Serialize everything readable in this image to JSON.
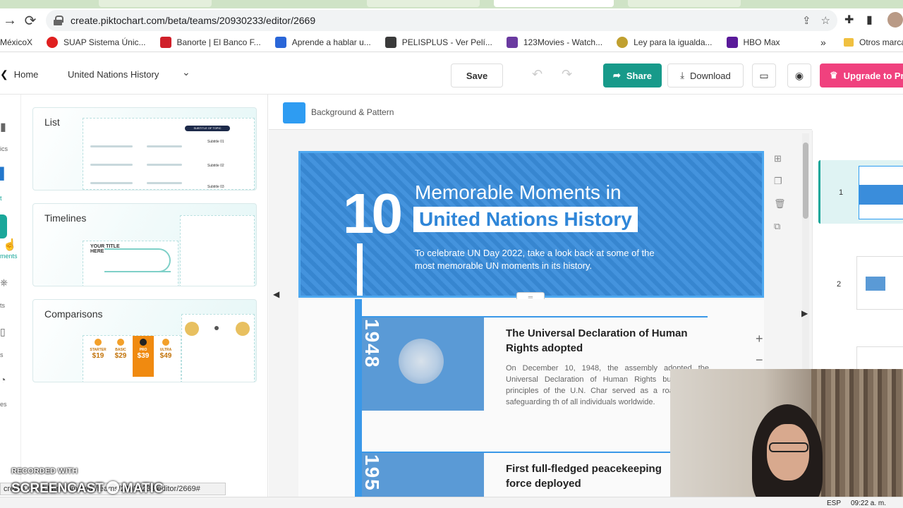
{
  "browser": {
    "url": "create.piktochart.com/beta/teams/20930233/editor/2669",
    "bookmarks": [
      {
        "label": "MéxicoX",
        "color": "#ffffff"
      },
      {
        "label": "SUAP Sistema Únic...",
        "color": "#e02020"
      },
      {
        "label": "Banorte | El Banco F...",
        "color": "#d0202a"
      },
      {
        "label": "Aprende a hablar u...",
        "color": "#2a66d8"
      },
      {
        "label": "PELISPLUS - Ver Pelí...",
        "color": "#3a3a3a"
      },
      {
        "label": "123Movies - Watch...",
        "color": "#6a3aa0"
      },
      {
        "label": "Ley para la igualda...",
        "color": "#c0a030"
      },
      {
        "label": "HBO Max",
        "color": "#5a1a9a"
      }
    ],
    "bookmarks_more": "»",
    "other_bookmarks": "Otros marca"
  },
  "header": {
    "home": "Home",
    "doc_title": "United Nations History",
    "save": "Save",
    "share": "Share",
    "download": "Download",
    "upgrade": "Upgrade to Pr"
  },
  "rail": [
    "ics",
    "t",
    "ments",
    "ts",
    "s",
    "es"
  ],
  "panel": {
    "cards": [
      {
        "title": "List",
        "subtitle_badge": "SUBTITLE OF TOPIC",
        "items": [
          "Subtitle 01",
          "Subtitle 02",
          "Subtitle 03"
        ]
      },
      {
        "title": "Timelines",
        "your_title": "YOUR TITLE HERE"
      },
      {
        "title": "Comparisons",
        "prices": [
          {
            "plan": "STARTER",
            "value": "$19"
          },
          {
            "plan": "BASIC",
            "value": "$29"
          },
          {
            "plan": "PRO",
            "value": "$39"
          },
          {
            "plan": "ULTRA",
            "value": "$49"
          }
        ]
      }
    ]
  },
  "canvas": {
    "background_label": "Background & Pattern",
    "colors": {
      "hero": "#3a8ddb",
      "accent": "#3a98e8",
      "brand_green": "#179a8a",
      "upgrade_pink": "#f0417e"
    },
    "hero": {
      "number": "10",
      "title_line1": "Memorable Moments in",
      "title_line2": "United Nations History",
      "subtitle": "To celebrate UN Day 2022, take a look back at some of the most memorable UN moments in its history."
    },
    "entries": [
      {
        "year": "1948",
        "title": "The Universal Declaration of Human Rights adopted",
        "body": "On December 10, 1948, the assembly adopted the Universal Declaration of Human Rights built on the principles of the U.N. Char served as a road map to safeguarding th of all individuals worldwide."
      },
      {
        "year": "195",
        "title": "First full-fledged peacekeeping force deployed",
        "body": ""
      }
    ]
  },
  "slides": [
    {
      "num": "1"
    },
    {
      "num": "2"
    },
    {
      "num": ""
    }
  ],
  "overlay": {
    "recorded_with": "RECORDED WITH",
    "screencast": "SCREENCAST",
    "matic": "MATIC",
    "status_url": "create.piktochart.com/beta/teams/20930233/editor/2669#"
  },
  "tray": {
    "lang": "ESP",
    "time": "09:22 a. m."
  }
}
